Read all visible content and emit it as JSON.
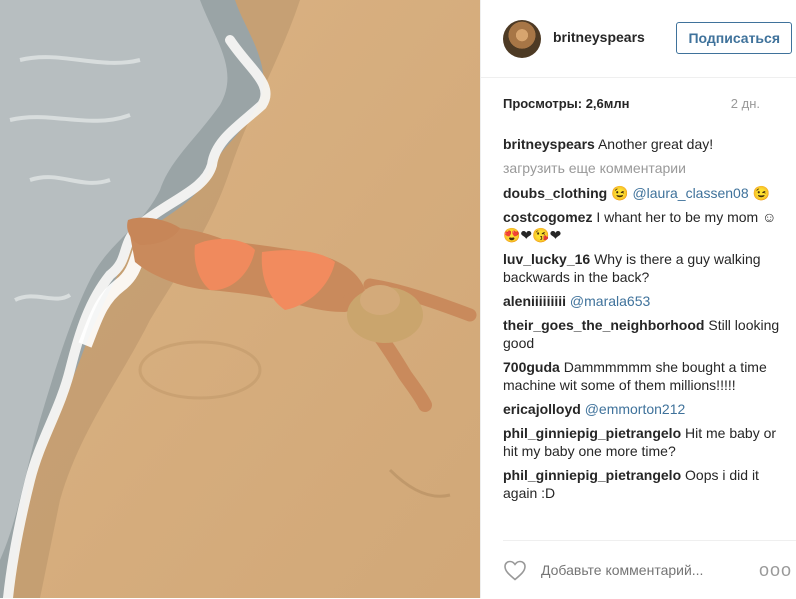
{
  "post": {
    "username": "britneyspears",
    "follow_label": "Подписаться",
    "views": "Просмотры: 2,6млн",
    "age": "2 дн."
  },
  "caption": {
    "user": "britneyspears",
    "text": "Another great day!"
  },
  "load_more_label": "загрузить еще комментарии",
  "comments": [
    {
      "user": "doubs_clothing",
      "pre": "😉 ",
      "mention": "@laura_classen08",
      "post": " 😉"
    },
    {
      "user": "costcogomez",
      "pre": "I whant her to be my mom ☺😍❤😘❤",
      "mention": "",
      "post": ""
    },
    {
      "user": "luv_lucky_16",
      "pre": "Why is there a guy walking backwards in the back?",
      "mention": "",
      "post": ""
    },
    {
      "user": "aleniiiiiiiii",
      "pre": "",
      "mention": "@marala653",
      "post": ""
    },
    {
      "user": "their_goes_the_neighborhood",
      "pre": "Still looking good",
      "mention": "",
      "post": ""
    },
    {
      "user": "700guda",
      "pre": "Dammmmmm she bought a time machine wit some of them millions!!!!!",
      "mention": "",
      "post": ""
    },
    {
      "user": "ericajolloyd",
      "pre": "",
      "mention": "@emmorton212",
      "post": ""
    },
    {
      "user": "phil_ginniepig_pietrangelo",
      "pre": "Hit me baby or hit my baby one more time?",
      "mention": "",
      "post": ""
    },
    {
      "user": "phil_ginniepig_pietrangelo",
      "pre": "Oops i did it again :D",
      "mention": "",
      "post": ""
    }
  ],
  "footer": {
    "placeholder": "Добавьте комментарий...",
    "more": "ooo"
  },
  "icons": {
    "like": "heart-outline-icon",
    "more": "more-options-icon"
  },
  "colors": {
    "link": "#3f729b",
    "muted": "#999999",
    "text": "#262626"
  }
}
